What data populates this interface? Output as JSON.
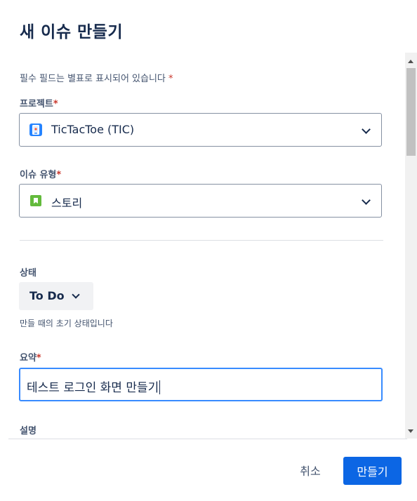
{
  "dialog": {
    "title": "새 이슈 만들기",
    "required_note": "필수 필드는 별표로 표시되어 있습니다",
    "required_marker": "*"
  },
  "project": {
    "label": "프로젝트",
    "value": "TicTacToe (TIC)",
    "icon": "project-avatar-icon"
  },
  "issue_type": {
    "label": "이슈 유형",
    "value": "스토리",
    "icon": "story-icon",
    "icon_color": "#6a9a23"
  },
  "status": {
    "label": "상태",
    "value": "To Do",
    "helper": "만들 때의 초기 상태입니다"
  },
  "summary": {
    "label": "요약",
    "value": "테스트 로그인 화면 만들기"
  },
  "description": {
    "label": "설명"
  },
  "footer": {
    "cancel_label": "취소",
    "create_label": "만들기"
  },
  "colors": {
    "primary": "#0c66e4",
    "focus_border": "#388bff",
    "required": "#c9372c"
  }
}
